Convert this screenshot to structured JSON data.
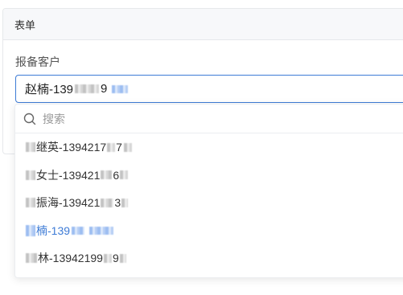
{
  "form": {
    "header_title": "表单",
    "field_label": "报备客户",
    "selected_value_prefix": "赵楠-139",
    "selected_value_suffix": "9"
  },
  "dropdown": {
    "search_placeholder": "搜索",
    "options": [
      {
        "prefix": "",
        "text": "继英-1394217",
        "tail": "7",
        "selected": false
      },
      {
        "prefix": "",
        "text": "女士-139421",
        "tail": "6",
        "selected": false
      },
      {
        "prefix": "",
        "text": "振海-139421",
        "tail": "3",
        "selected": false
      },
      {
        "prefix": "",
        "text": "楠-139",
        "tail": "",
        "selected": true
      },
      {
        "prefix": "",
        "text": "林-13942199",
        "tail": "9",
        "selected": false
      }
    ]
  },
  "colors": {
    "accent": "#3d7bd6",
    "header_bg": "#f7f8fa",
    "border": "#e6e8eb"
  }
}
